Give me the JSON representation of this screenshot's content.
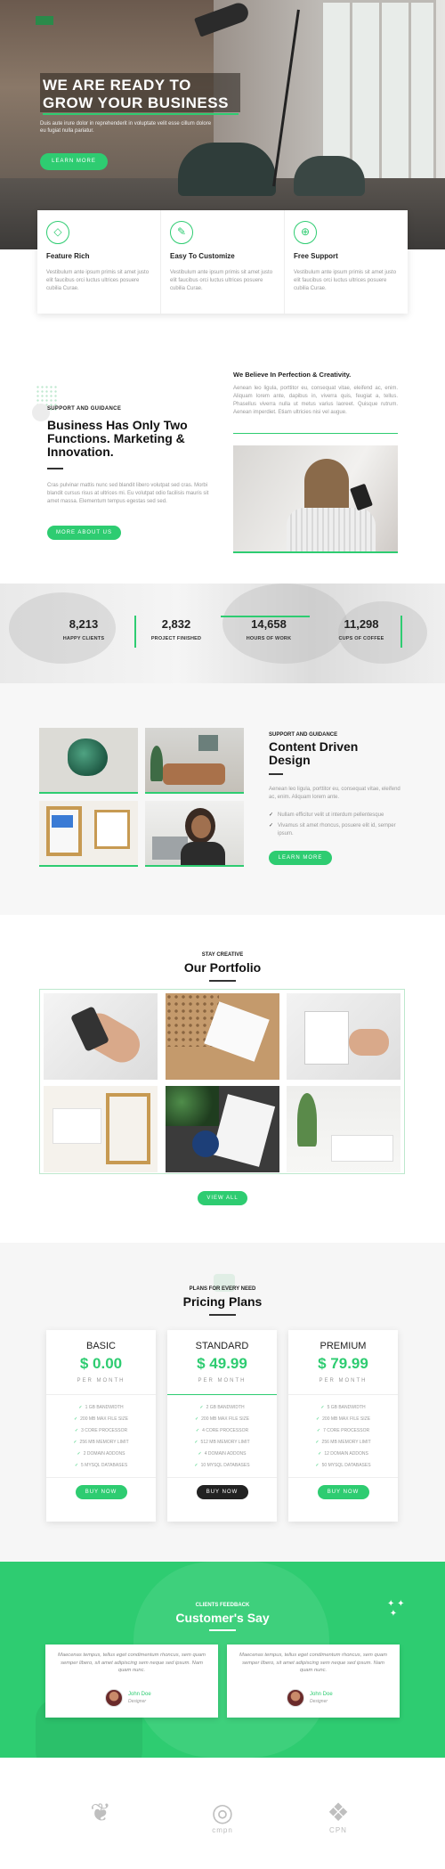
{
  "hero": {
    "title_line1": "WE ARE READY TO",
    "title_line2": "GROW YOUR BUSINESS",
    "subtitle": "Duis aute irure dolor in reprehenderit in voluptate velit esse cillum dolore eu fugiat nulla pariatur.",
    "button": "LEARN MORE"
  },
  "features": [
    {
      "icon": "diamond-icon",
      "title": "Feature Rich",
      "text": "Vestibulum ante ipsum primis sit amet justo elit faucibus orci luctus ultrices posuere cubilia Curae."
    },
    {
      "icon": "wrench-icon",
      "title": "Easy To Customize",
      "text": "Vestibulum ante ipsum primis sit amet justo elit faucibus orci luctus ultrices posuere cubilia Curae."
    },
    {
      "icon": "globe-icon",
      "title": "Free Support",
      "text": "Vestibulum ante ipsum primis sit amet justo elit faucibus orci luctus ultrices posuere cubilia Curae."
    }
  ],
  "about": {
    "kicker": "SUPPORT AND GUIDANCE",
    "title": "Business Has Only Two Functions. Marketing & Innovation.",
    "text": "Cras pulvinar mattis nunc sed blandit libero volutpat sed cras. Morbi blandit cursus risus at ultrices mi. Eu volutpat odio facilisis mauris sit amet massa. Elementum tempus egestas sed sed.",
    "button": "MORE ABOUT US",
    "believe_title": "We Believe In Perfection & Creativity.",
    "believe_text": "Aenean leo ligula, porttitor eu, consequat vitae, eleifend ac, enim. Aliquam lorem ante, dapibus in, viverra quis, feugiat a, tellus. Phasellus viverra nulla ut metus varius laoreet. Quisque rutrum. Aenean imperdiet. Etiam ultricies nisi vel augue."
  },
  "stats": [
    {
      "num": "8,213",
      "label": "HAPPY CLIENTS"
    },
    {
      "num": "2,832",
      "label": "PROJECT FINISHED"
    },
    {
      "num": "14,658",
      "label": "HOURS OF WORK"
    },
    {
      "num": "11,298",
      "label": "CUPS OF COFFEE"
    }
  ],
  "content": {
    "kicker": "SUPPORT AND GUIDANCE",
    "title": "Content Driven Design",
    "text": "Aenean leo ligula, porttitor eu, consequat vitae, eleifend ac, enim. Aliquam lorem ante.",
    "list": [
      "Nullam efficitur velit ut interdum pellentesque",
      "Vivamus sit amet rhoncus, posuere elit id, semper ipsum."
    ],
    "button": "LEARN MORE"
  },
  "portfolio": {
    "kicker": "STAY CREATIVE",
    "title": "Our Portfolio",
    "button": "VIEW ALL"
  },
  "pricing": {
    "kicker": "PLANS FOR EVERY NEED",
    "title": "Pricing Plans",
    "plans": [
      {
        "name": "BASIC",
        "price": "$ 0.00",
        "period": "PER MONTH",
        "features": [
          "1 GB BANDWIDTH",
          "200 MB MAX FILE SIZE",
          "3 CORE PROCESSOR",
          "256 MB MEMORY LIMIT",
          "2 DOMAIN ADDONS",
          "5 MYSQL DATABASES"
        ],
        "button": "BUY NOW"
      },
      {
        "name": "STANDARD",
        "price": "$ 49.99",
        "period": "PER MONTH",
        "features": [
          "2 GB BANDWIDTH",
          "200 MB MAX FILE SIZE",
          "4 CORE PROCESSOR",
          "512 MB MEMORY LIMIT",
          "4 DOMAIN ADDONS",
          "10 MYSQL DATABASES"
        ],
        "button": "BUY NOW"
      },
      {
        "name": "PREMIUM",
        "price": "$ 79.99",
        "period": "PER MONTH",
        "features": [
          "5 GB BANDWIDTH",
          "200 MB MAX FILE SIZE",
          "7 CORE PROCESSOR",
          "256 MB MEMORY LIMIT",
          "12 DOMAIN ADDONS",
          "50 MYSQL DATABASES"
        ],
        "button": "BUY NOW"
      }
    ]
  },
  "testimonials": {
    "kicker": "CLIENTS FEEDBACK",
    "title": "Customer's Say",
    "items": [
      {
        "quote": "Maecenas tempus, tellus eget condimentum rhoncus, sem quam semper libero, sit amet adipiscing sem neque sed ipsum. Nam quam nunc.",
        "name": "John Doe",
        "role": "Designer"
      },
      {
        "quote": "Maecenas tempus, tellus eget condimentum rhoncus, sem quam semper libero, sit amet adipiscing sem neque sed ipsum. Nam quam nunc.",
        "name": "John Doe",
        "role": "Designer"
      }
    ]
  },
  "logos": [
    {
      "icon": "bird-logo-icon",
      "text": ""
    },
    {
      "icon": "cmpn-logo-icon",
      "text": "cmpn"
    },
    {
      "icon": "cpn-logo-icon",
      "text": "CPN"
    }
  ],
  "colors": {
    "accent": "#2ecc71",
    "dark": "#222222"
  }
}
